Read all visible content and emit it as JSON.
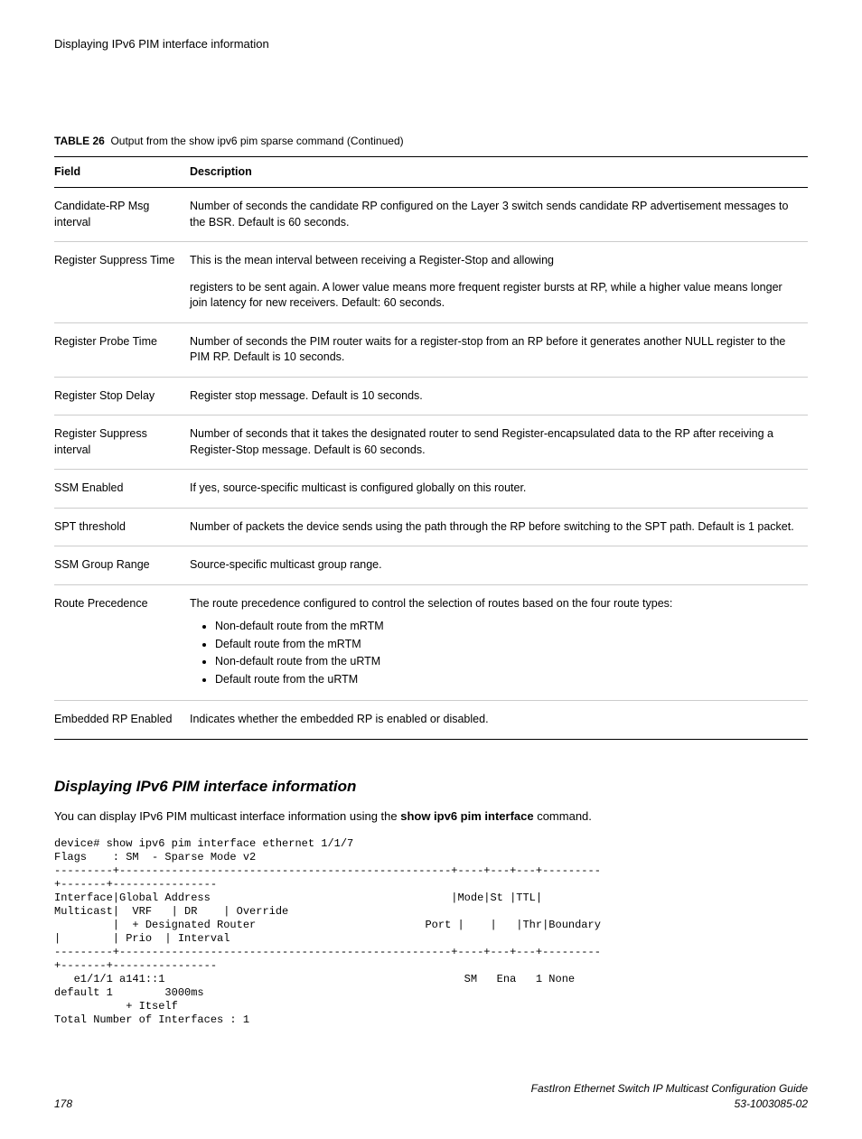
{
  "header": "Displaying IPv6 PIM interface information",
  "table_title_label": "TABLE 26",
  "table_title_text": "Output from the show ipv6 pim sparse command (Continued)",
  "columns": {
    "field": "Field",
    "desc": "Description"
  },
  "rows": {
    "r1f": "Candidate-RP Msg interval",
    "r1d": "Number of seconds the candidate RP configured on the Layer 3 switch sends candidate RP advertisement messages to the BSR. Default is 60 seconds.",
    "r2f": "Register Suppress Time",
    "r2d1": "This is the mean interval between receiving a Register-Stop and allowing",
    "r2d2": "registers to be sent again. A lower value means more frequent register bursts at RP, while a higher value means longer join latency for new receivers. Default: 60 seconds.",
    "r3f": "Register Probe Time",
    "r3d": "Number of seconds the PIM router waits for a register-stop from an RP before it generates another NULL register to the PIM RP. Default is 10 seconds.",
    "r4f": "Register Stop Delay",
    "r4d": "Register stop message. Default is 10 seconds.",
    "r5f": "Register Suppress interval",
    "r5d": "Number of seconds that it takes the designated router to send Register-encapsulated data to the RP after receiving a Register-Stop message. Default is 60 seconds.",
    "r6f": "SSM Enabled",
    "r6d": "If yes, source-specific multicast is configured globally on this router.",
    "r7f": "SPT threshold",
    "r7d": "Number of packets the device sends using the path through the RP before switching to the SPT path. Default is 1 packet.",
    "r8f": "SSM Group Range",
    "r8d": "Source-specific multicast group range.",
    "r9f": "Route Precedence",
    "r9d_intro": "The route precedence configured to control the selection of routes based on the four route types:",
    "r9b1": "Non-default route from the mRTM",
    "r9b2": "Default route from the mRTM",
    "r9b3": "Non-default route from the uRTM",
    "r9b4": "Default route from the uRTM",
    "r10f": "Embedded RP Enabled",
    "r10d": "Indicates whether the embedded RP is enabled or disabled."
  },
  "section_heading": "Displaying IPv6 PIM interface information",
  "body_pre": "You can display IPv6 PIM multicast interface information using the ",
  "body_cmd": "show ipv6 pim interface",
  "body_post": " command.",
  "code": "device# show ipv6 pim interface ethernet 1/1/7\nFlags    : SM  - Sparse Mode v2\n---------+---------------------------------------------------+----+---+---+---------\n+-------+----------------\nInterface|Global Address                                     |Mode|St |TTL|\nMulticast|  VRF   | DR    | Override\n         |  + Designated Router                          Port |    |   |Thr|Boundary\n|        | Prio  | Interval\n---------+---------------------------------------------------+----+---+---+---------\n+-------+----------------\n   e1/1/1 a141::1                                              SM   Ena   1 None\ndefault 1        3000ms\n           + Itself\nTotal Number of Interfaces : 1",
  "footer": {
    "page": "178",
    "title": "FastIron Ethernet Switch IP Multicast Configuration Guide",
    "docnum": "53-1003085-02"
  }
}
